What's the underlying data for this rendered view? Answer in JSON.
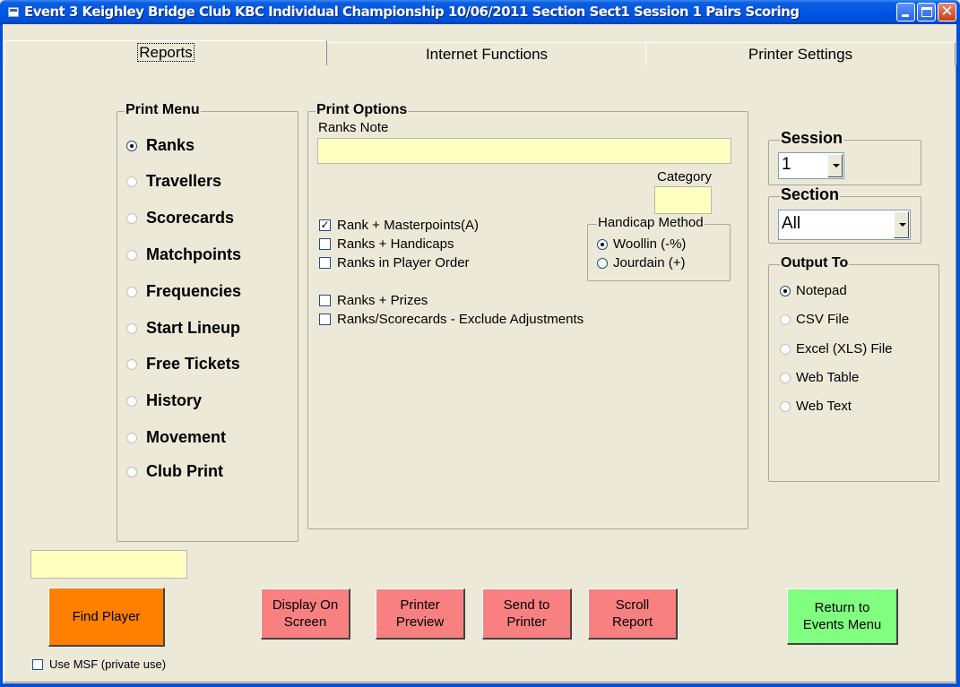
{
  "window": {
    "title": "Event 3  Keighley Bridge Club KBC Individual Championship 10/06/2011 Section Sect1 Session 1 Pairs Scoring"
  },
  "tabs": [
    {
      "label": "Reports",
      "selected": true
    },
    {
      "label": "Internet Functions",
      "selected": false
    },
    {
      "label": "Printer Settings",
      "selected": false
    }
  ],
  "print_menu": {
    "title": "Print Menu",
    "items": [
      {
        "label": "Ranks",
        "selected": true
      },
      {
        "label": "Travellers",
        "selected": false
      },
      {
        "label": "Scorecards",
        "selected": false
      },
      {
        "label": "Matchpoints",
        "selected": false
      },
      {
        "label": "Frequencies",
        "selected": false
      },
      {
        "label": "Start Lineup",
        "selected": false
      },
      {
        "label": "Free Tickets",
        "selected": false
      },
      {
        "label": "History",
        "selected": false
      },
      {
        "label": "Movement",
        "selected": false
      },
      {
        "label": "Club Print",
        "selected": false
      }
    ]
  },
  "print_options": {
    "title": "Print Options",
    "ranks_note_label": "Ranks Note",
    "ranks_note_value": "",
    "category_label": "Category",
    "category_value": "",
    "checks": [
      {
        "label": "Rank + Masterpoints(A)",
        "checked": true
      },
      {
        "label": "Ranks + Handicaps",
        "checked": false
      },
      {
        "label": "Ranks in Player Order",
        "checked": false
      },
      {
        "label": "Ranks + Prizes",
        "checked": false
      },
      {
        "label": "Ranks/Scorecards - Exclude Adjustments",
        "checked": false
      }
    ],
    "handicap": {
      "title": "Handicap Method",
      "options": [
        {
          "label": "Woollin (-%)",
          "selected": true
        },
        {
          "label": "Jourdain (+)",
          "selected": false
        }
      ]
    }
  },
  "session": {
    "title": "Session",
    "value": "1"
  },
  "section": {
    "title": "Section",
    "value": "All"
  },
  "output_to": {
    "title": "Output To",
    "options": [
      {
        "label": "Notepad",
        "selected": true
      },
      {
        "label": "CSV File",
        "selected": false
      },
      {
        "label": "Excel (XLS) File",
        "selected": false
      },
      {
        "label": "Web Table",
        "selected": false
      },
      {
        "label": "Web Text",
        "selected": false
      }
    ]
  },
  "player_search_value": "",
  "buttons": {
    "find_player": "Find Player",
    "display_on_screen": "Display On\nScreen",
    "printer_preview": "Printer\nPreview",
    "send_to_printer": "Send to\nPrinter",
    "scroll_report": "Scroll\nReport",
    "return_to_events": "Return to\nEvents Menu"
  },
  "use_msf": {
    "label": "Use MSF (private use)",
    "checked": false
  },
  "colors": {
    "window_bg": "#ece9d8",
    "title_bar": "#0055e5",
    "input_yellow": "#ffffc0",
    "button_pink": "#f88080",
    "button_orange": "#ff8000",
    "button_green": "#80ff80"
  }
}
